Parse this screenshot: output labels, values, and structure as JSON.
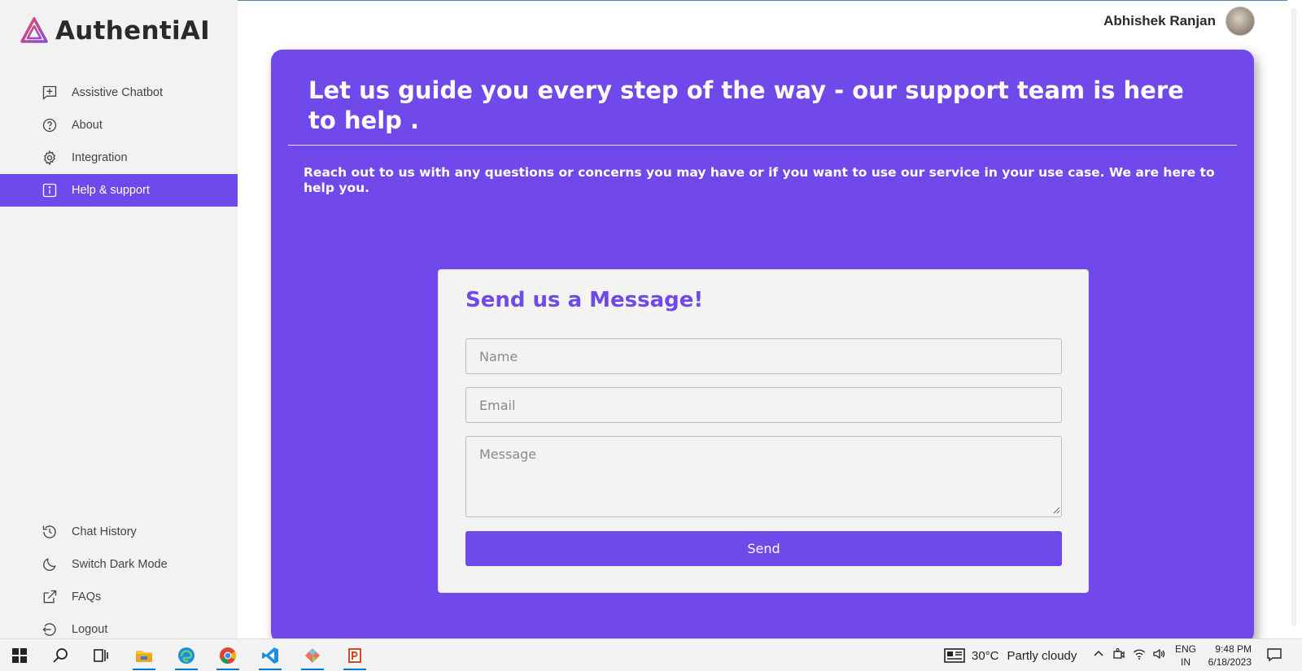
{
  "app": {
    "name": "AuthentiAI"
  },
  "sidebar": {
    "items": [
      {
        "label": "Assistive Chatbot",
        "icon": "chat-plus-icon"
      },
      {
        "label": "About",
        "icon": "question-circle-icon"
      },
      {
        "label": "Integration",
        "icon": "gear-icon"
      },
      {
        "label": "Help & support",
        "icon": "info-square-icon",
        "active": true
      }
    ],
    "bottom_items": [
      {
        "label": "Chat History",
        "icon": "history-icon"
      },
      {
        "label": "Switch Dark Mode",
        "icon": "moon-icon"
      },
      {
        "label": "FAQs",
        "icon": "external-link-icon"
      },
      {
        "label": "Logout",
        "icon": "logout-icon"
      }
    ]
  },
  "header": {
    "user_name": "Abhishek Ranjan"
  },
  "main": {
    "title": "Let us guide you every step of the way - our support team is here to help .",
    "subtitle": "Reach out to us with any questions or concerns you may have or if you want to use our service in your use case. We are here to help you."
  },
  "contact_form": {
    "title": "Send us a Message!",
    "name_placeholder": "Name",
    "email_placeholder": "Email",
    "message_placeholder": "Message",
    "send_label": "Send"
  },
  "taskbar": {
    "weather_temp": "30°C",
    "weather_text": "Partly cloudy",
    "lang_top": "ENG",
    "lang_bottom": "IN",
    "time": "9:48 PM",
    "date": "6/18/2023"
  },
  "colors": {
    "accent": "#6f49ea",
    "sidebar_bg": "#f2f2f2",
    "card_bg": "#f3f3f3"
  }
}
